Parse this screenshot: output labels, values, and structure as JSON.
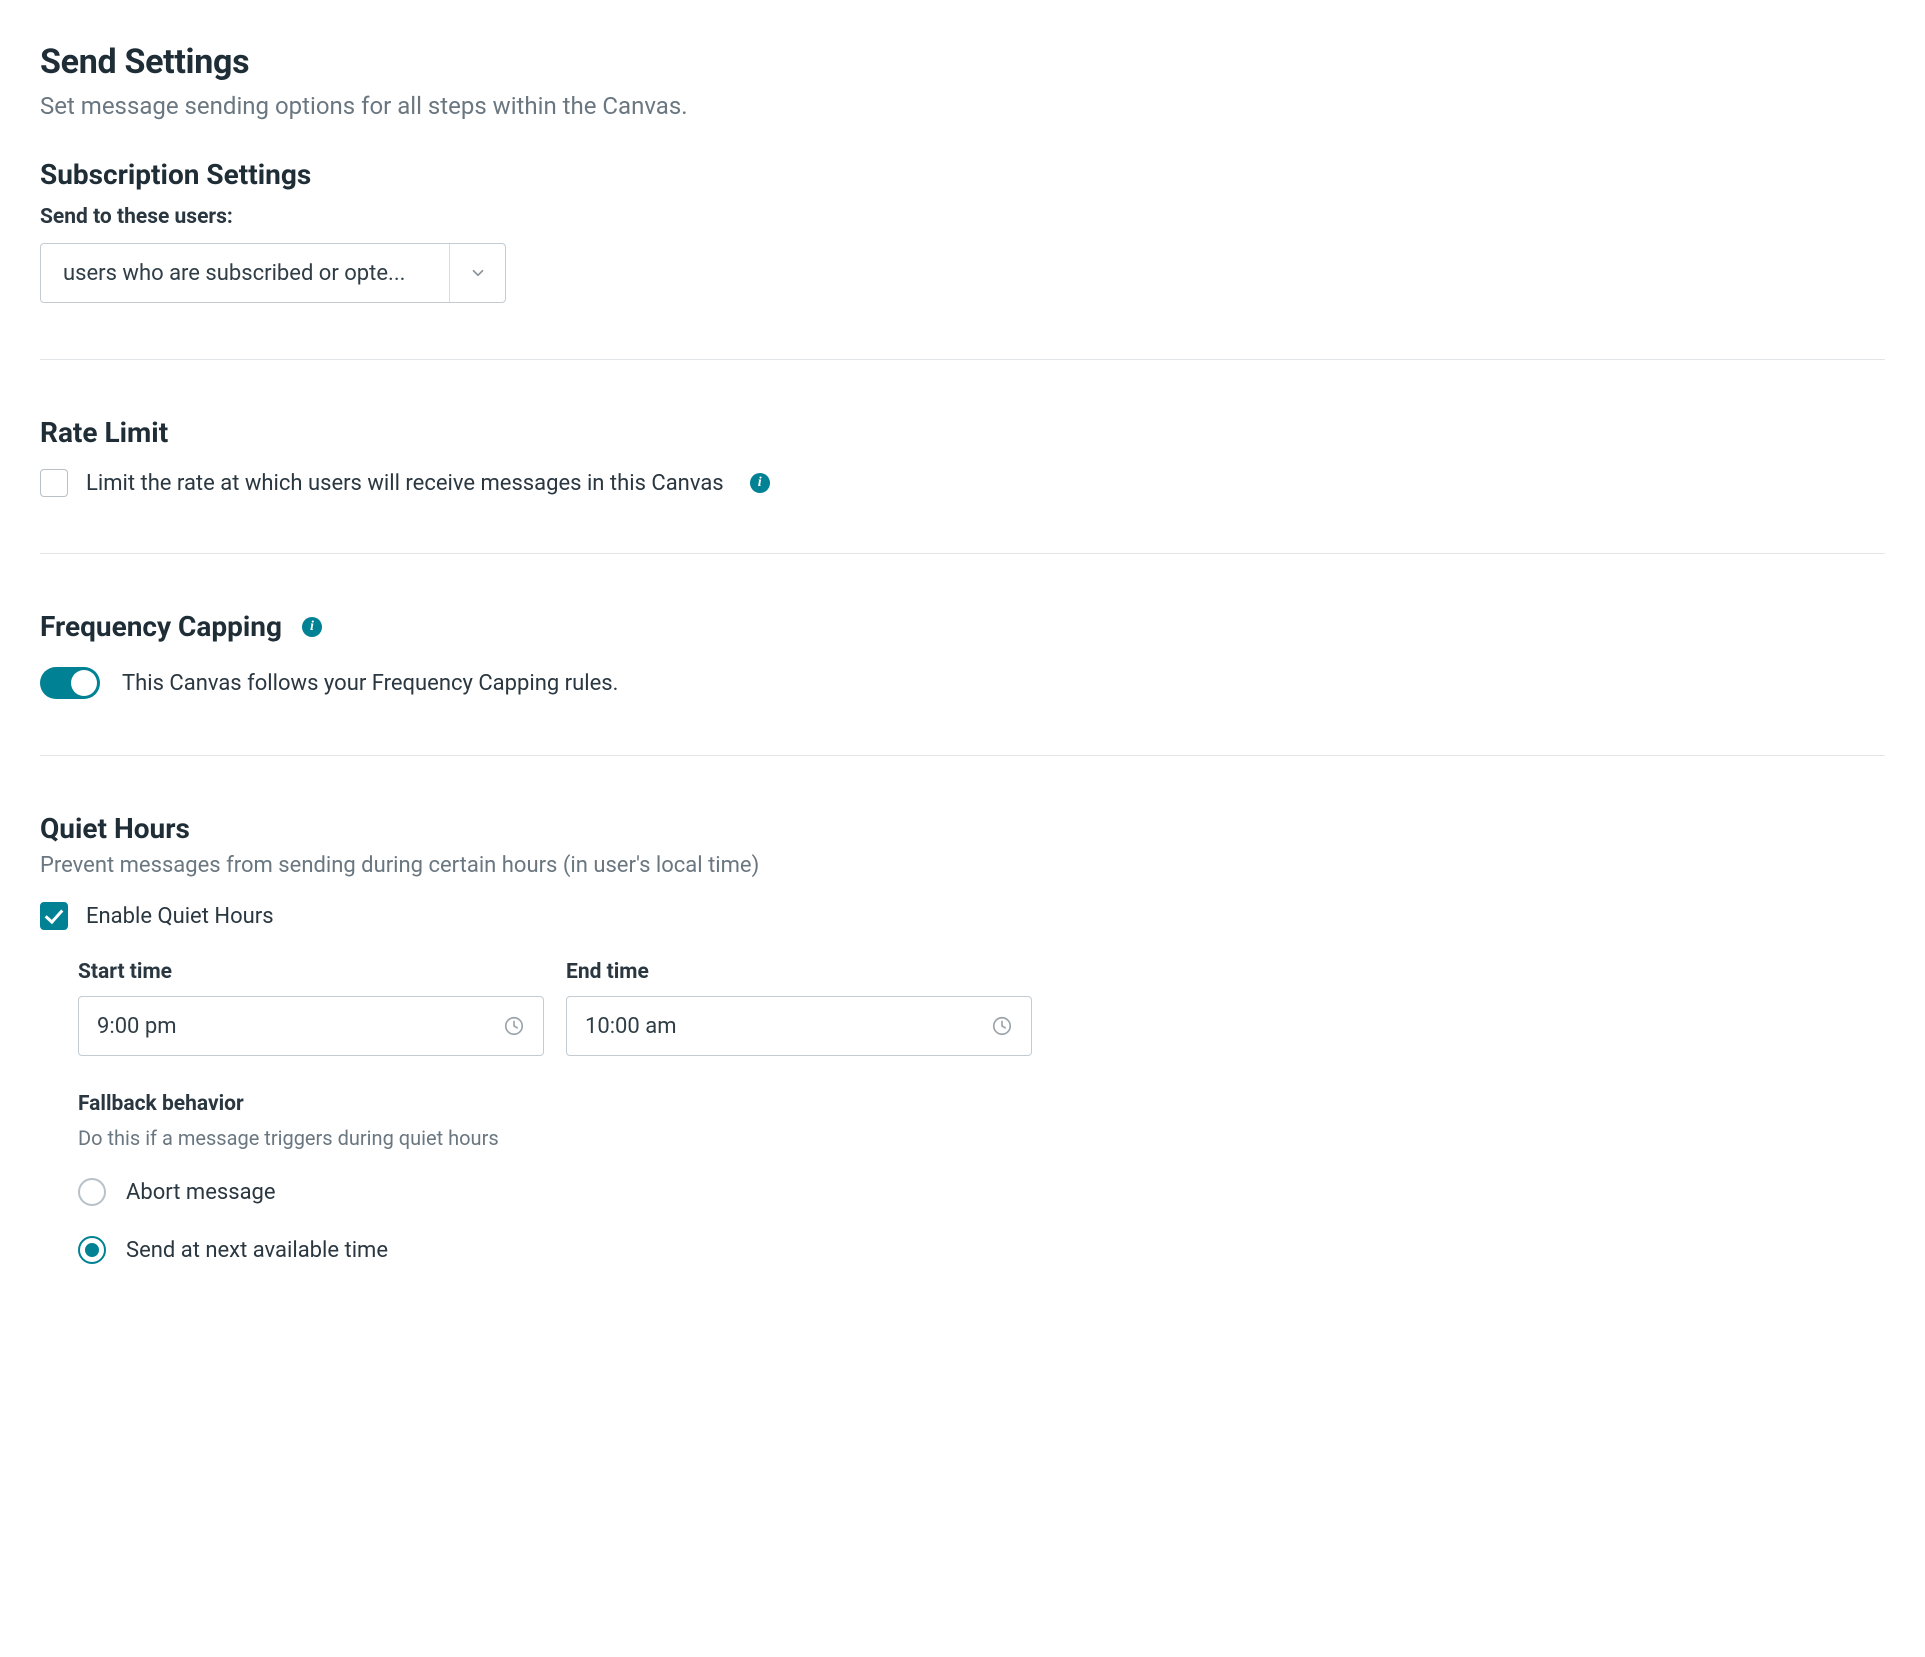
{
  "header": {
    "title": "Send Settings",
    "subtitle": "Set message sending options for all steps within the Canvas."
  },
  "subscription": {
    "title": "Subscription Settings",
    "field_label": "Send to these users:",
    "selected": "users who are subscribed or opte..."
  },
  "rate_limit": {
    "title": "Rate Limit",
    "checkbox_label": "Limit the rate at which users will receive messages in this Canvas",
    "checked": false
  },
  "frequency_capping": {
    "title": "Frequency Capping",
    "toggle_label": "This Canvas follows your Frequency Capping rules.",
    "enabled": true
  },
  "quiet_hours": {
    "title": "Quiet Hours",
    "description": "Prevent messages from sending during certain hours (in user's local time)",
    "enable_label": "Enable Quiet Hours",
    "enabled": true,
    "start_label": "Start time",
    "start_value": "9:00 pm",
    "end_label": "End time",
    "end_value": "10:00 am",
    "fallback": {
      "title": "Fallback behavior",
      "description": "Do this if a message triggers during quiet hours",
      "options": {
        "abort": "Abort message",
        "send_next": "Send at next available time"
      },
      "selected": "send_next"
    }
  }
}
